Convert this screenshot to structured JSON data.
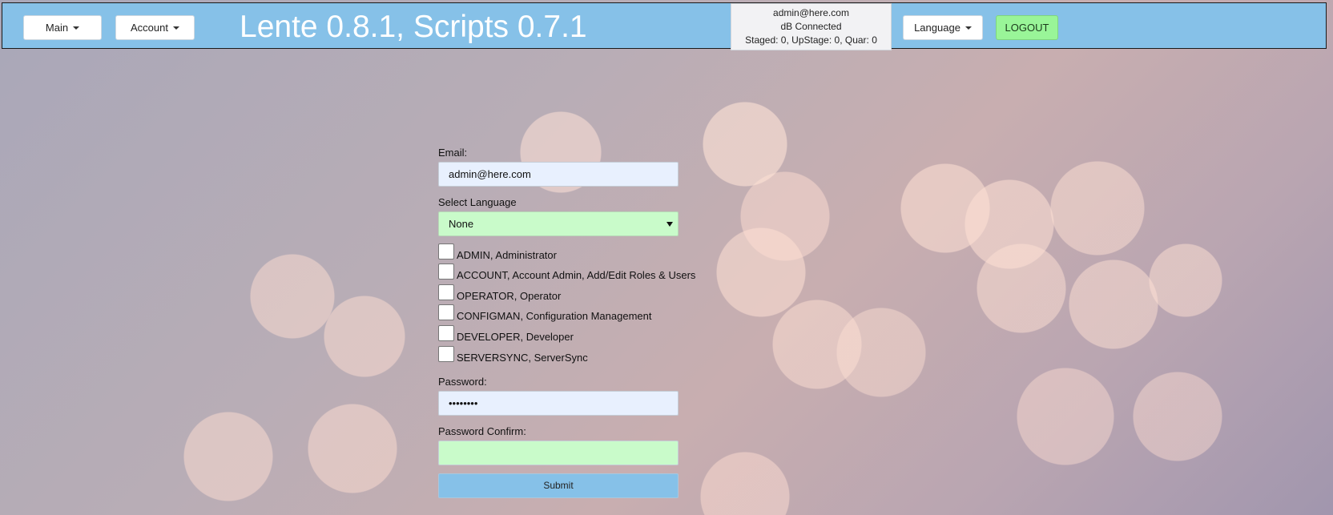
{
  "header": {
    "main_menu_label": "Main",
    "account_menu_label": "Account",
    "app_title": "Lente 0.8.1, Scripts 0.7.1",
    "status": {
      "user": "admin@here.com",
      "db_status": "dB Connected",
      "counts": "Staged: 0, UpStage: 0, Quar: 0"
    },
    "language_menu_label": "Language",
    "logout_label": "LOGOUT"
  },
  "form": {
    "email_label": "Email:",
    "email_value": "admin@here.com",
    "language_label": "Select Language",
    "language_value": "None",
    "roles": [
      {
        "label": "ADMIN, Administrator",
        "checked": false
      },
      {
        "label": "ACCOUNT, Account Admin, Add/Edit Roles & Users",
        "checked": false
      },
      {
        "label": "OPERATOR, Operator",
        "checked": false
      },
      {
        "label": "CONFIGMAN, Configuration Management",
        "checked": false
      },
      {
        "label": "DEVELOPER, Developer",
        "checked": false
      },
      {
        "label": "SERVERSYNC, ServerSync",
        "checked": false
      }
    ],
    "password_label": "Password:",
    "password_value": "••••••••",
    "password_confirm_label": "Password Confirm:",
    "password_confirm_value": "",
    "submit_label": "Submit"
  },
  "colors": {
    "header_bg": "#86c1e8",
    "logout_bg": "#99f598",
    "field_highlight": "#c9fbca",
    "autofill_bg": "#e8f0fe"
  }
}
